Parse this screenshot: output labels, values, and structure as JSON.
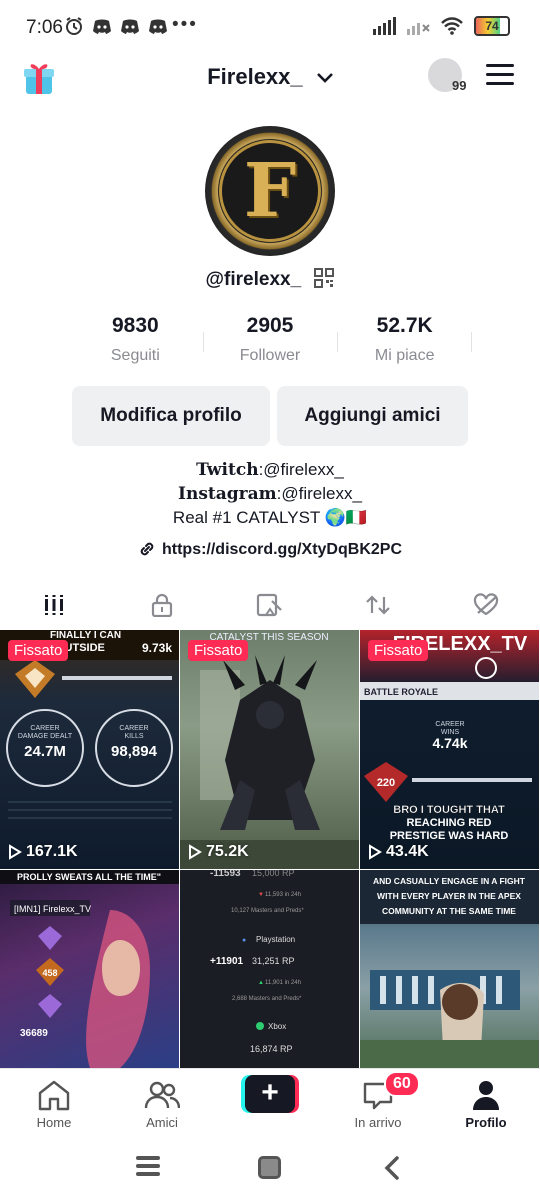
{
  "status_bar": {
    "time": "7:06",
    "dots": "•••",
    "battery": "74"
  },
  "header": {
    "username": "Firelexx_",
    "visitors_count": "99"
  },
  "profile": {
    "avatar_letter": "F",
    "handle": "@firelexx_",
    "stats": [
      {
        "value": "9830",
        "label": "Seguiti"
      },
      {
        "value": "2905",
        "label": "Follower"
      },
      {
        "value": "52.7K",
        "label": "Mi piace"
      }
    ],
    "edit_button": "Modifica profilo",
    "add_friends_button": "Aggiungi amici",
    "bio": {
      "line1_bold": "Twitch",
      "line1_rest": ":@firelexx_",
      "line2_bold": "Instagram",
      "line2_rest": ":@firelexx_",
      "line3": "Real #1 CATALYST 🌍🇮🇹"
    },
    "link": "https://discord.gg/XtyDqBK2PC"
  },
  "tabs": [
    "videos-grid-icon",
    "lock-icon",
    "tagged-icon",
    "repost-icon",
    "liked-hidden-icon"
  ],
  "videos": [
    {
      "pinned_label": "Fissato",
      "views": "167.1K",
      "caption_top": "FINALLY I CAN\nOUTSIDE",
      "stat1": "9.73k",
      "stat2": "24.7M",
      "stat2_label": "CAREER\nDAMAGE DEALT",
      "stat3": "98,894",
      "stat3_label": "CAREER\nKILLS"
    },
    {
      "pinned_label": "Fissato",
      "views": "75.2K",
      "caption_top": "CATALYST THIS SEASON"
    },
    {
      "pinned_label": "Fissato",
      "views": "43.4K",
      "caption_top": "FIRELEXX_TV",
      "sub": "BATTLE ROYALE",
      "wins": "4.74k",
      "overlay": "BRO I TOUGHT THAT\nREACHING RED\nPRESTIGE WAS HARD",
      "level": "220"
    },
    {
      "caption_top": "PROLLY SWEATS ALL THE TIME\"",
      "name": "[IMN1] Firelexx_TV",
      "level": "458",
      "kills": "36689"
    },
    {
      "rp1": "-11593",
      "rp1_val": "15,000 RP",
      "p1": "11,593 in 24h",
      "m1": "10,127 Masters and Preds*",
      "platform": "Playstation",
      "rp2": "+11901",
      "rp2_val": "31,251 RP",
      "p2": "11,901 in 24h",
      "m2": "2,688 Masters and Preds*",
      "platform2": "Xbox",
      "rp3_val": "16,874 RP"
    },
    {
      "caption_top": "AND CASUALLY ENGAGE IN A FIGHT\nWITH EVERY PLAYER IN THE APEX\nCOMMUNITY AT THE SAME TIME"
    }
  ],
  "bottom_nav": [
    {
      "label": "Home"
    },
    {
      "label": "Amici"
    },
    {
      "label": "+"
    },
    {
      "label": "In arrivo",
      "badge": "60"
    },
    {
      "label": "Profilo"
    }
  ],
  "colors": {
    "accent": "#fe2c55",
    "cyan": "#25f4ee"
  }
}
